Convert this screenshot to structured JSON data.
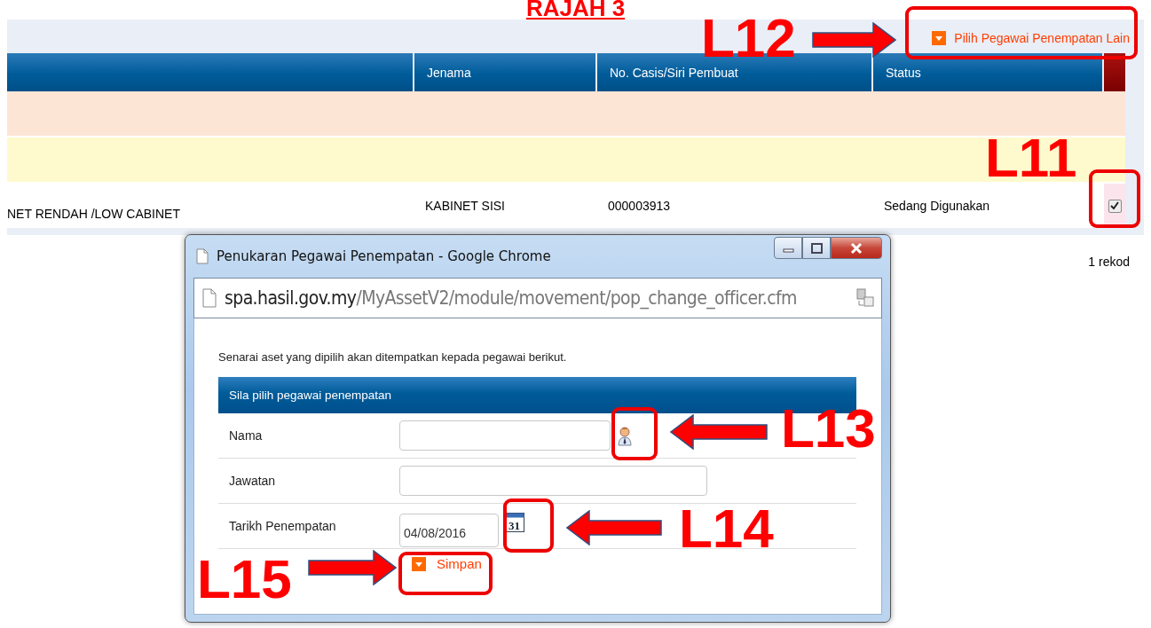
{
  "heading": "RAJAH 3",
  "top_link": {
    "label": "Pilih Pegawai Penempatan Lain"
  },
  "table": {
    "columns": [
      "",
      "Jenama",
      "No. Casis/Siri Pembuat",
      "Status"
    ],
    "bands": [
      {
        "color": "#fde5d6"
      },
      {
        "color": "#fffacd"
      }
    ],
    "rows": [
      {
        "cells": [
          "NET RENDAH /LOW CABINET",
          "KABINET SISI",
          "000003913",
          "Sedang Digunakan"
        ],
        "checked": true
      }
    ],
    "footer": "1 rekod"
  },
  "popup": {
    "title": "Penukaran Pegawai Penempatan - Google Chrome",
    "url_host": "spa.hasil.gov.my",
    "url_path": "/MyAssetV2/module/movement/pop_change_officer.cfm",
    "intro": "Senarai aset yang dipilih akan ditempatkan kepada pegawai berikut.",
    "section": "Sila pilih pegawai penempatan",
    "fields": [
      {
        "label": "Nama",
        "kind": "lookup"
      },
      {
        "label": "Jawatan",
        "kind": "text"
      },
      {
        "label": "Tarikh Penempatan",
        "kind": "date",
        "value": "04/08/2016",
        "icon_text": "31"
      }
    ],
    "button": "Simpan"
  },
  "annotations": [
    {
      "label": "L12"
    },
    {
      "label": "L11"
    },
    {
      "label": "L13"
    },
    {
      "label": "L14"
    },
    {
      "label": "L15"
    }
  ]
}
